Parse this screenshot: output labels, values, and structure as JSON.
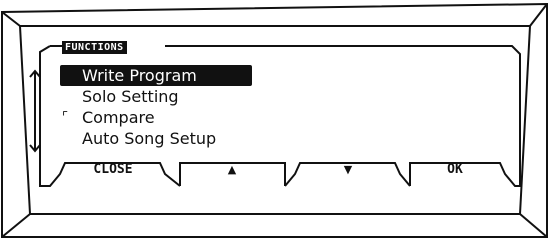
{
  "panel": {
    "title": "FUNCTIONS"
  },
  "menu": {
    "items": [
      {
        "label": "Write Program",
        "selected": true,
        "check": ""
      },
      {
        "label": "Solo Setting",
        "selected": false,
        "check": ""
      },
      {
        "label": "Compare",
        "selected": false,
        "check": "⌜"
      },
      {
        "label": "Auto Song Setup",
        "selected": false,
        "check": ""
      }
    ]
  },
  "softkeys": {
    "close": "CLOSE",
    "up": "▲",
    "down": "▼",
    "ok": "OK"
  },
  "icons": {
    "scroll": "scroll-updown-icon"
  },
  "colors": {
    "ink": "#111111",
    "background": "#ffffff"
  }
}
